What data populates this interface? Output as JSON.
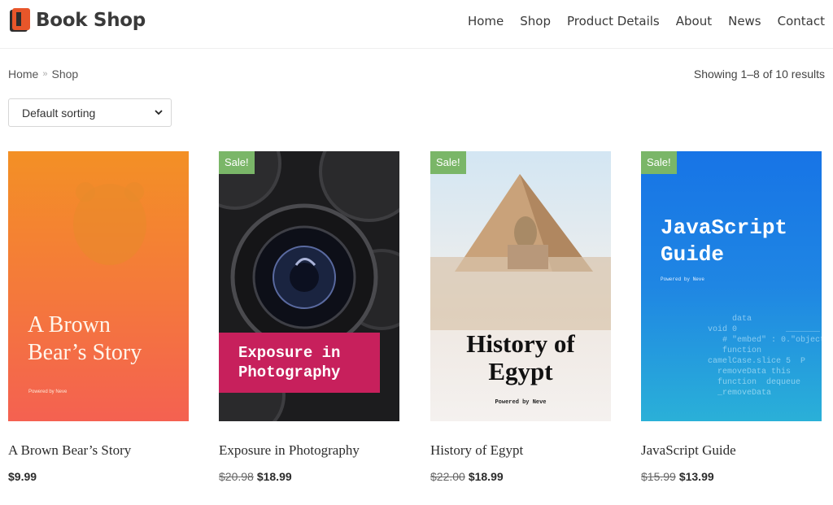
{
  "header": {
    "logo_text": "Book Shop",
    "nav": [
      "Home",
      "Shop",
      "Product Details",
      "About",
      "News",
      "Contact"
    ]
  },
  "breadcrumb": {
    "home": "Home",
    "separator": "»",
    "current": "Shop"
  },
  "results_text": "Showing 1–8 of 10 results",
  "sorting": {
    "selected": "Default sorting"
  },
  "colors": {
    "sale_badge": "#7ab668",
    "logo_accent": "#e8562a"
  },
  "products": [
    {
      "title": "A Brown Bear’s Story",
      "price": "$9.99",
      "old_price": "",
      "sale": false,
      "cover": {
        "line1": "A Brown",
        "line2": "Bear’s Story",
        "powered": "Powered by Neve"
      }
    },
    {
      "title": "Exposure in Photography",
      "price": "$18.99",
      "old_price": "$20.98",
      "sale": true,
      "sale_label": "Sale!",
      "cover": {
        "line1": "Exposure in",
        "line2": "Photography"
      }
    },
    {
      "title": "History of Egypt",
      "price": "$18.99",
      "old_price": "$22.00",
      "sale": true,
      "sale_label": "Sale!",
      "cover": {
        "line1": "History of",
        "line2": "Egypt",
        "powered": "Powered by Neve"
      }
    },
    {
      "title": "JavaScript Guide",
      "price": "$13.99",
      "old_price": "$15.99",
      "sale": true,
      "sale_label": "Sale!",
      "cover": {
        "line1": "JavaScript",
        "line2": "Guide",
        "powered": "Powered by Neve"
      }
    }
  ]
}
